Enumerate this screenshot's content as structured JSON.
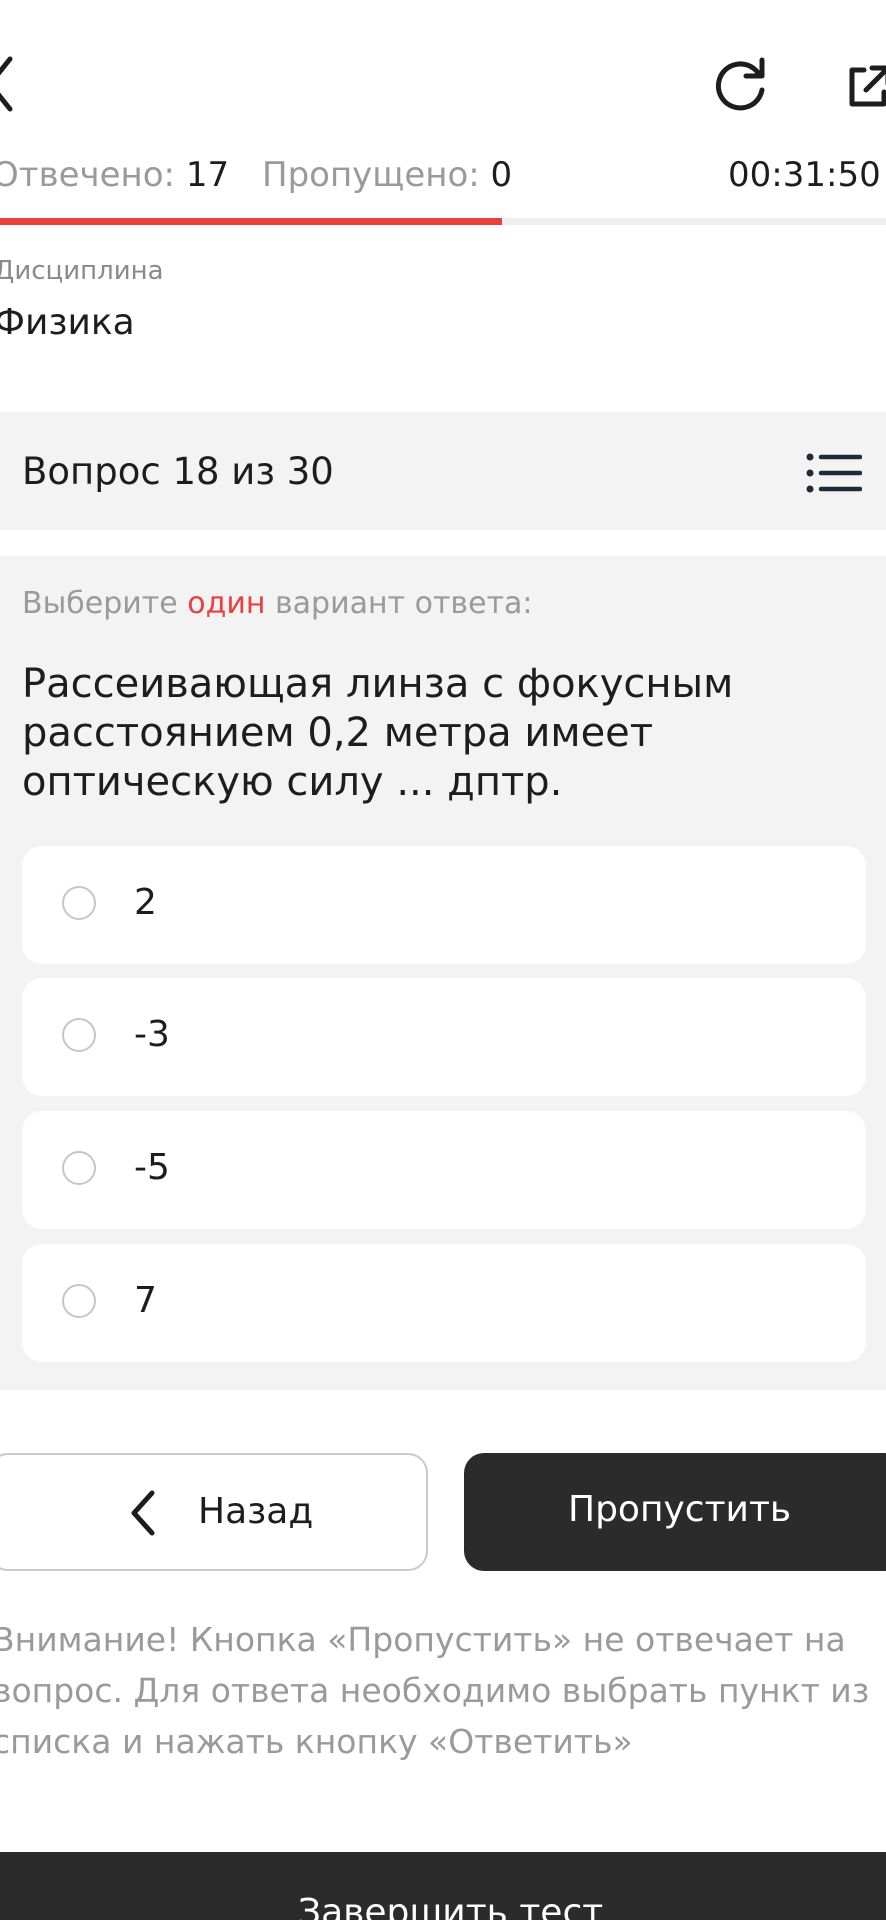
{
  "header": {
    "back_icon": "chevron-left-icon",
    "reload_icon": "reload-icon",
    "share_icon": "external-link-icon"
  },
  "status": {
    "answered_label": "Отвечено:",
    "answered_value": "17",
    "skipped_label": "Пропущено:",
    "skipped_value": "0",
    "timer": "00:31:50"
  },
  "progress": {
    "fraction": 0.567,
    "fill_color": "#e8413e",
    "track_color": "#efefef"
  },
  "discipline": {
    "label": "Дисциплина",
    "value": "Физика"
  },
  "question_header": {
    "text": "Вопрос 18 из 30",
    "list_icon": "list-icon"
  },
  "question": {
    "instruction_prefix": "Выберите ",
    "instruction_accent": "один",
    "instruction_suffix": " вариант ответа:",
    "text": "Рассеивающая линза с фокусным расстоянием 0,2 метра имеет оптическую силу ... дптр.",
    "options": [
      {
        "label": "2"
      },
      {
        "label": "-3"
      },
      {
        "label": "-5"
      },
      {
        "label": "7"
      }
    ]
  },
  "buttons": {
    "back_label": "Назад",
    "skip_label": "Пропустить",
    "finish_label": "Завершить тест"
  },
  "warning": "Внимание! Кнопка «Пропустить» не отвечает на вопрос. Для ответа необходимо выбрать пункт из списка и нажать кнопку «Ответить»",
  "colors": {
    "accent": "#e8413e",
    "dark_button": "#2b2b2b",
    "panel": "#f3f3f3"
  }
}
